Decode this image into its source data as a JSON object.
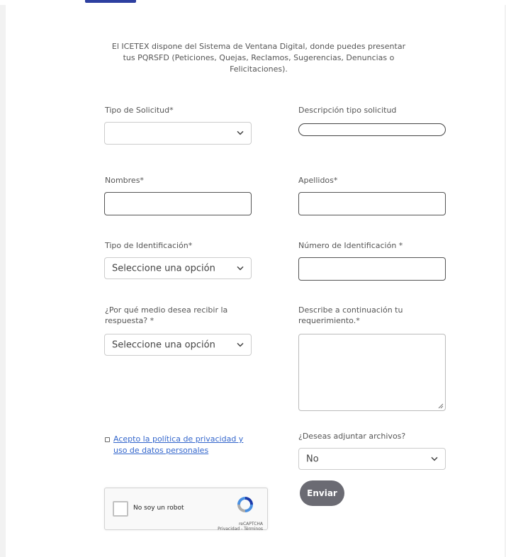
{
  "intro": "El ICETEX dispone del Sistema de Ventana Digital, donde puedes presentar tus PQRSFD (Peticiones, Quejas, Reclamos, Sugerencias, Denuncias o Felicitaciones).",
  "fields": {
    "tipo_solicitud_label": "Tipo de Solicitud*",
    "tipo_solicitud_value": "",
    "descripcion_label": "Descripción tipo solicitud",
    "nombres_label": "Nombres*",
    "apellidos_label": "Apellidos*",
    "tipo_id_label": "Tipo de Identificación*",
    "tipo_id_value": "Seleccione una opción",
    "numero_id_label": "Número de Identificación *",
    "medio_label": "¿Por qué medio desea recibir la respuesta? *",
    "medio_value": "Seleccione una opción",
    "requerimiento_label": "Describe a continuación tu requerimiento.*",
    "policy_link": "Acepto la política de privacidad y uso de datos personales",
    "adjuntar_label": "¿Deseas adjuntar archivos?",
    "adjuntar_value": "No"
  },
  "buttons": {
    "send": "Enviar"
  },
  "captcha": {
    "label": "No soy un robot",
    "brand": "reCAPTCHA",
    "links": "Privacidad - Términos"
  },
  "colors": {
    "link": "#3366cc",
    "send_bg": "#6b6b73",
    "logo": "#2d3fa0"
  }
}
